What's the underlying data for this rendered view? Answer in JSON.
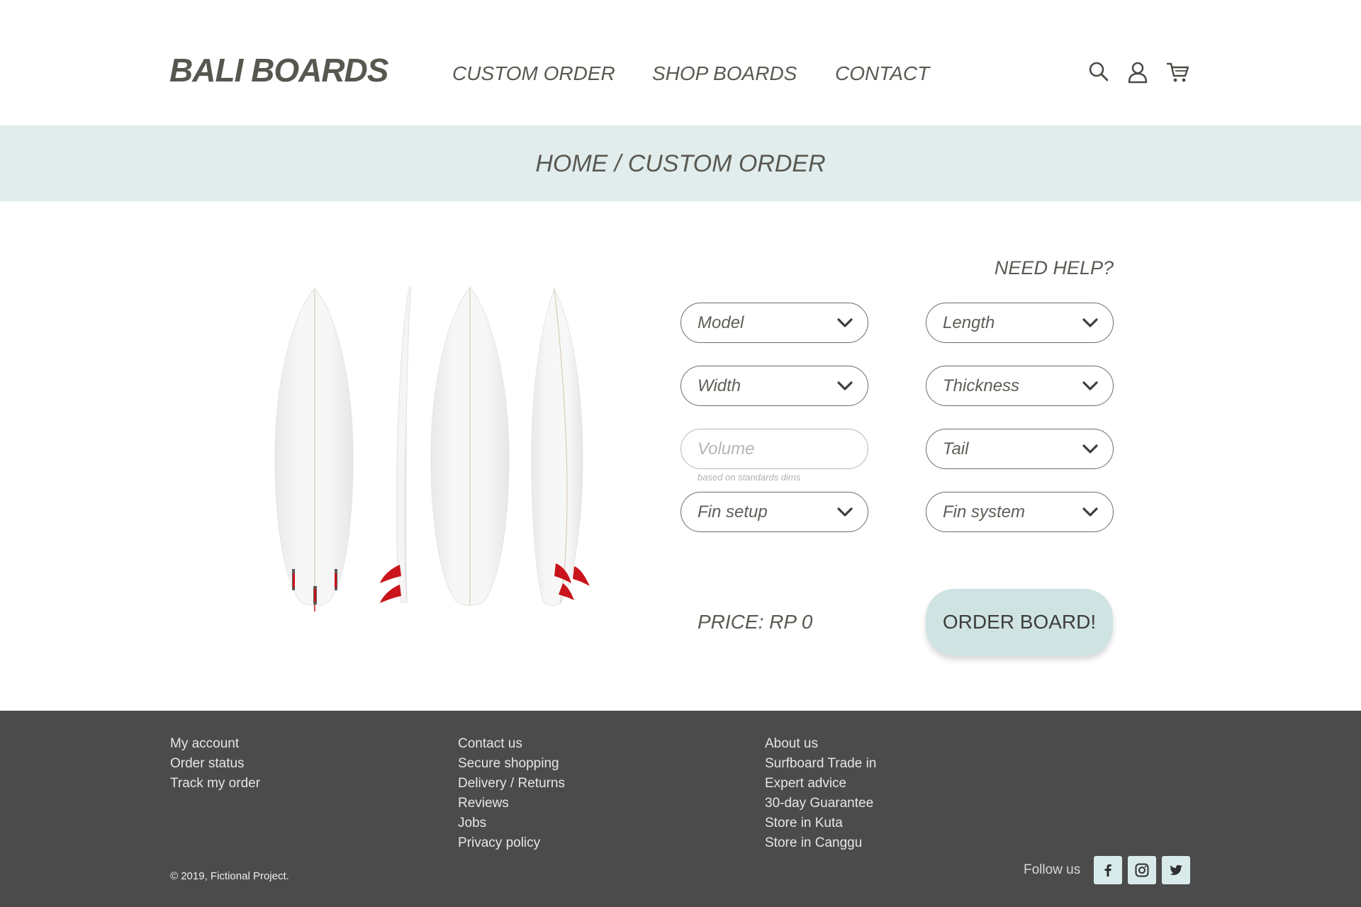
{
  "header": {
    "logo": "BALI BOARDS",
    "nav": [
      "CUSTOM ORDER",
      "SHOP BOARDS",
      "CONTACT"
    ],
    "icons": [
      "search-icon",
      "user-icon",
      "cart-icon"
    ]
  },
  "breadcrumb": "HOME / CUSTOM ORDER",
  "form": {
    "need_help": "NEED HELP?",
    "model": "Model",
    "length": "Length",
    "width": "Width",
    "thickness": "Thickness",
    "volume_placeholder": "Volume",
    "volume_hint": "based on standards dims",
    "tail": "Tail",
    "fin_setup": "Fin setup",
    "fin_system": "Fin system",
    "price": "PRICE: RP 0",
    "order_button": "ORDER BOARD!"
  },
  "footer": {
    "col1": [
      "My account",
      "Order status",
      "Track my order"
    ],
    "col2": [
      "Contact us",
      "Secure shopping",
      "Delivery / Returns",
      "Reviews",
      "Jobs",
      "Privacy policy"
    ],
    "col3": [
      "About us",
      "Surfboard Trade in",
      "Expert advice",
      "30-day Guarantee",
      "Store in Kuta",
      "Store in Canggu"
    ],
    "copyright": "© 2019, Fictional Project.",
    "follow": "Follow us",
    "social": [
      "facebook-icon",
      "instagram-icon",
      "twitter-icon"
    ]
  },
  "colors": {
    "band": "#e1eded",
    "button": "#cfe3e3",
    "footer": "#4b4b4b",
    "fin": "#c8141a",
    "text": "#5a5952"
  }
}
